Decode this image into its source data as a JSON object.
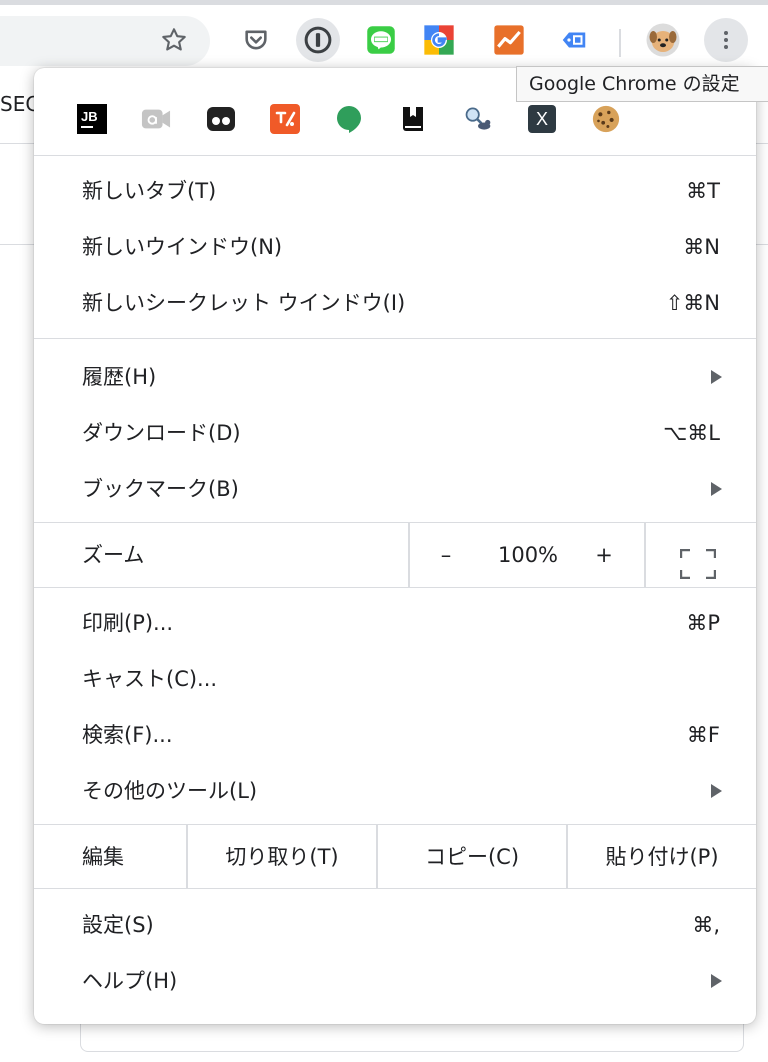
{
  "page": {
    "sec_text": "SEC"
  },
  "toolbar": {
    "icons": [
      "star-icon",
      "pocket-icon",
      "1password-icon",
      "line-icon",
      "google-icon",
      "analytics-icon",
      "tag-icon",
      "profile-avatar",
      "more-vert-icon"
    ],
    "colors": {
      "line": "#3ACD45",
      "analytics": "#E8702A",
      "tag": "#4285F4"
    }
  },
  "tooltip": {
    "text": "Google Chrome の設定"
  },
  "extensions": {
    "jb": "JB",
    "x": "X",
    "icons": [
      "jetbrains-icon",
      "alexa-icon",
      "tabbed-icon",
      "t-translate-icon",
      "hangouts-icon",
      "bookmark-icon",
      "search-dog-icon",
      "x-icon",
      "cookie-icon"
    ]
  },
  "menu": {
    "new_tab": {
      "label": "新しいタブ(T)",
      "shortcut": "⌘T"
    },
    "new_window": {
      "label": "新しいウインドウ(N)",
      "shortcut": "⌘N"
    },
    "new_incognito": {
      "label": "新しいシークレット ウインドウ(I)",
      "shortcut": "⇧⌘N"
    },
    "history": {
      "label": "履歴(H)"
    },
    "downloads": {
      "label": "ダウンロード(D)",
      "shortcut": "⌥⌘L"
    },
    "bookmarks": {
      "label": "ブックマーク(B)"
    },
    "zoom": {
      "label": "ズーム",
      "minus": "–",
      "value": "100%",
      "plus": "+"
    },
    "print": {
      "label": "印刷(P)...",
      "shortcut": "⌘P"
    },
    "cast": {
      "label": "キャスト(C)..."
    },
    "find": {
      "label": "検索(F)...",
      "shortcut": "⌘F"
    },
    "more_tools": {
      "label": "その他のツール(L)"
    },
    "edit": {
      "label": "編集",
      "cut": "切り取り(T)",
      "copy": "コピー(C)",
      "paste": "貼り付け(P)"
    },
    "settings": {
      "label": "設定(S)",
      "shortcut": "⌘,"
    },
    "help": {
      "label": "ヘルプ(H)"
    }
  }
}
